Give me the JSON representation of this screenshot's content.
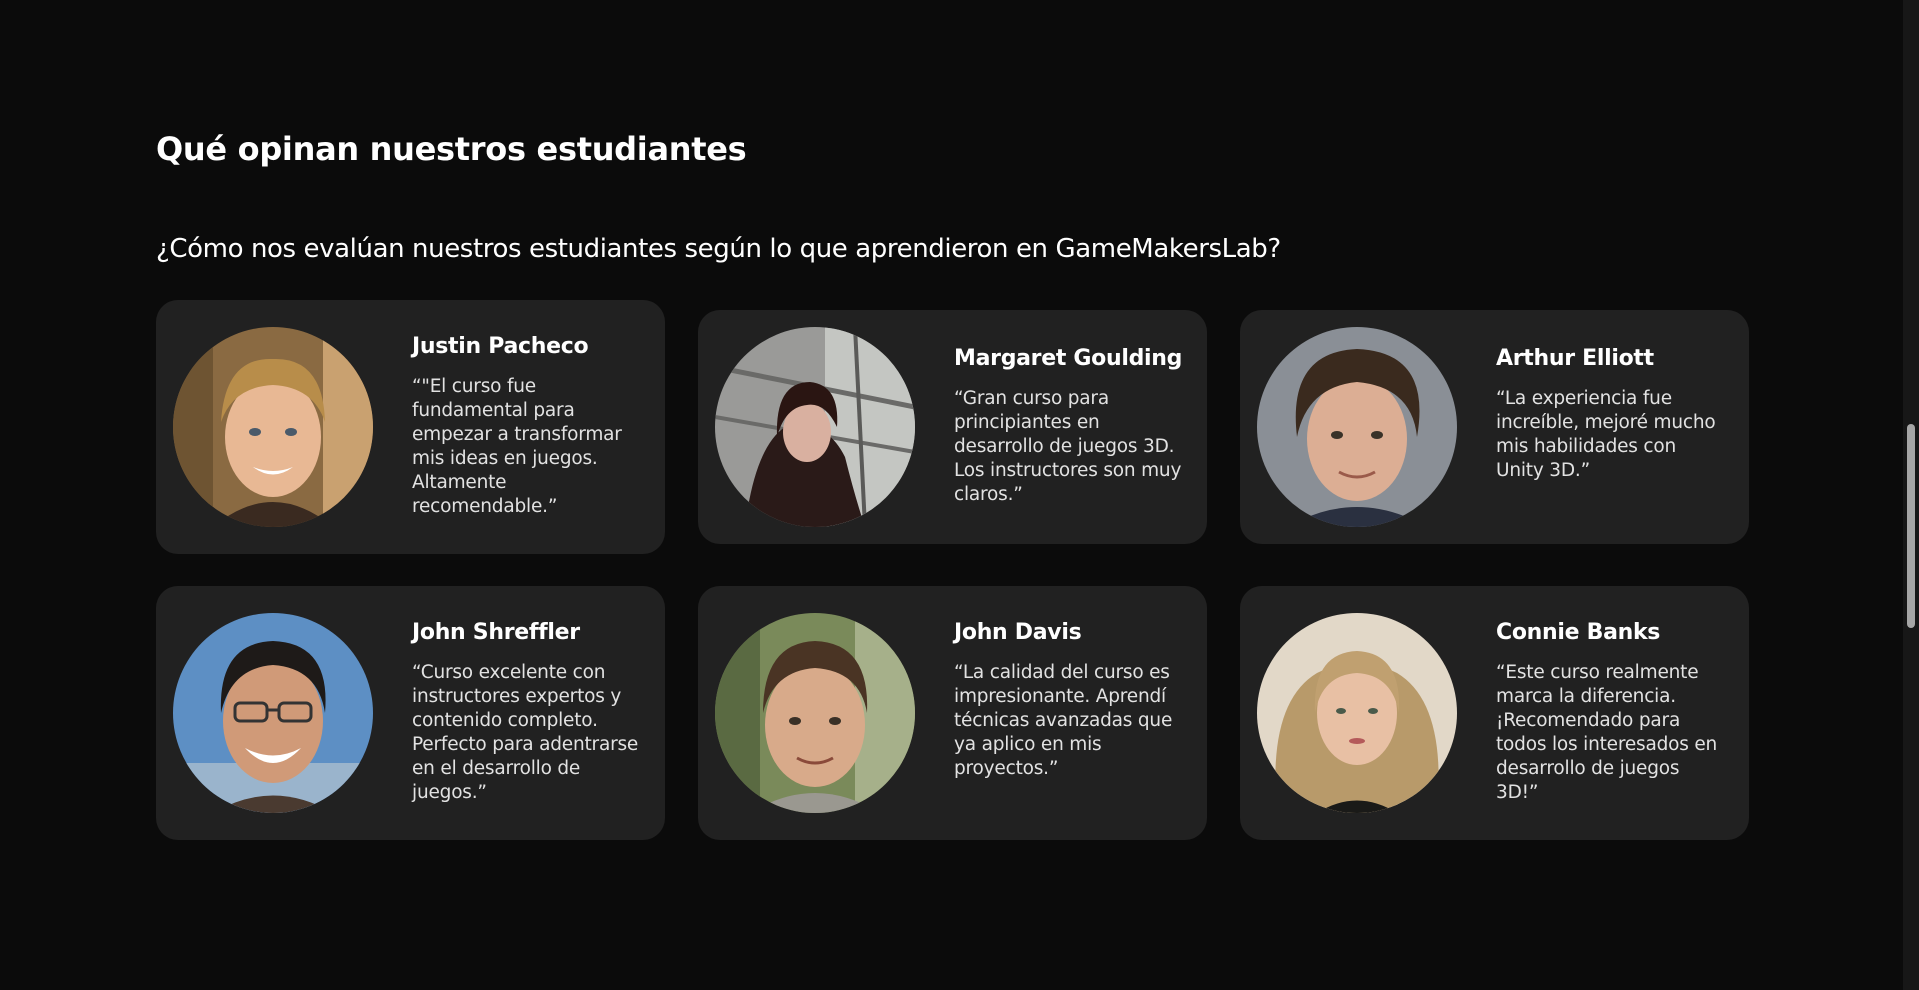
{
  "section": {
    "title": "Qué opinan nuestros estudiantes",
    "subtitle": "¿Cómo nos evalúan nuestros estudiantes según lo que aprendieron en GameMakersLab?"
  },
  "testimonials": [
    {
      "name": "Justin Pacheco",
      "quote": "“\"El curso fue fundamental para empezar a transformar mis ideas en juegos. Altamente recomendable.”",
      "avatar_icon": "student-photo-justin-pacheco"
    },
    {
      "name": "Margaret Goulding",
      "quote": "“Gran curso para principiantes en desarrollo de juegos 3D. Los instructores son muy claros.”",
      "avatar_icon": "student-photo-margaret-goulding"
    },
    {
      "name": "Arthur Elliott",
      "quote": "“La experiencia fue increíble, mejoré mucho mis habilidades con Unity 3D.”",
      "avatar_icon": "student-photo-arthur-elliott"
    },
    {
      "name": "John Shreffler",
      "quote": "“Curso excelente con instructores expertos y contenido completo. Perfecto para adentrarse en el desarrollo de juegos.”",
      "avatar_icon": "student-photo-john-shreffler"
    },
    {
      "name": "John Davis",
      "quote": "“La calidad del curso es impresionante. Aprendí técnicas avanzadas que ya aplico en mis proyectos.”",
      "avatar_icon": "student-photo-john-davis"
    },
    {
      "name": "Connie Banks",
      "quote": "“Este curso realmente marca la diferencia. ¡Recomendado para todos los interesados en desarrollo de juegos 3D!”",
      "avatar_icon": "student-photo-connie-banks"
    }
  ],
  "colors": {
    "background": "#0b0b0b",
    "card": "#212121",
    "text": "#ffffff",
    "quote_text": "#e2e2e2"
  }
}
